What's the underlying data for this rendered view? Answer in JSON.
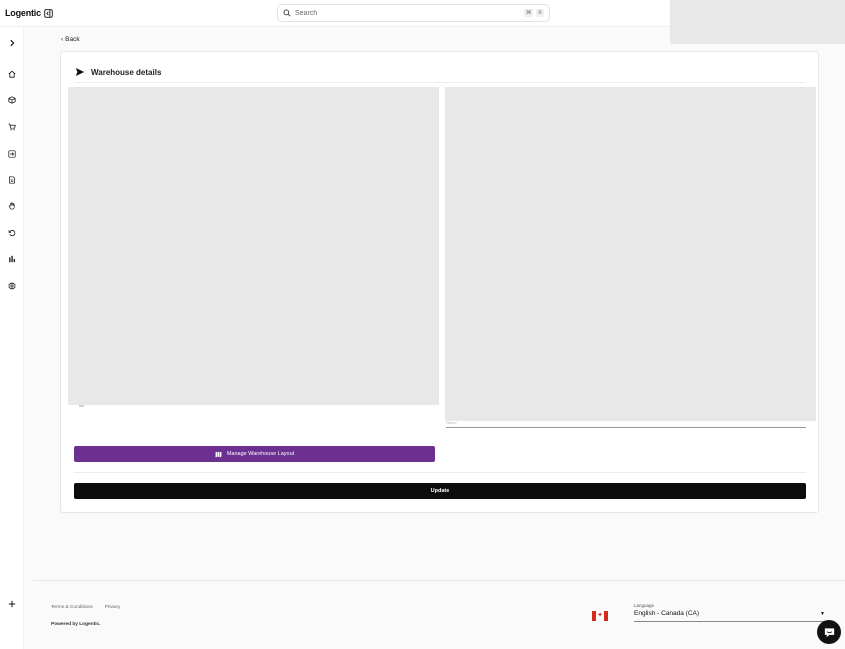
{
  "app": {
    "brand": "Logentic"
  },
  "search": {
    "placeholder": "Search",
    "shortcut_cmd": "⌘",
    "shortcut_key": "K"
  },
  "sidebar": {
    "items": [
      {
        "icon": "chevron-right-icon"
      },
      {
        "icon": "home-icon"
      },
      {
        "icon": "box-icon"
      },
      {
        "icon": "cart-icon"
      },
      {
        "icon": "login-icon"
      },
      {
        "icon": "document-icon"
      },
      {
        "icon": "hand-icon"
      },
      {
        "icon": "undo-icon"
      },
      {
        "icon": "bar-chart-icon"
      },
      {
        "icon": "gear-icon"
      },
      {
        "icon": "plus-icon"
      }
    ]
  },
  "page": {
    "back_label": "Back",
    "title": "Warehouse details",
    "peek_label": "Name",
    "manage_layout_label": "Manage Warehouse Layout",
    "update_label": "Update"
  },
  "footer": {
    "terms": "Terms & Conditions",
    "privacy": "Privacy",
    "powered_by": "Powered by Logentic.",
    "language_label": "Language",
    "language_value": "English - Canada (CA)"
  },
  "colors": {
    "accent": "#6c3190",
    "primary": "#0d0d0d"
  }
}
